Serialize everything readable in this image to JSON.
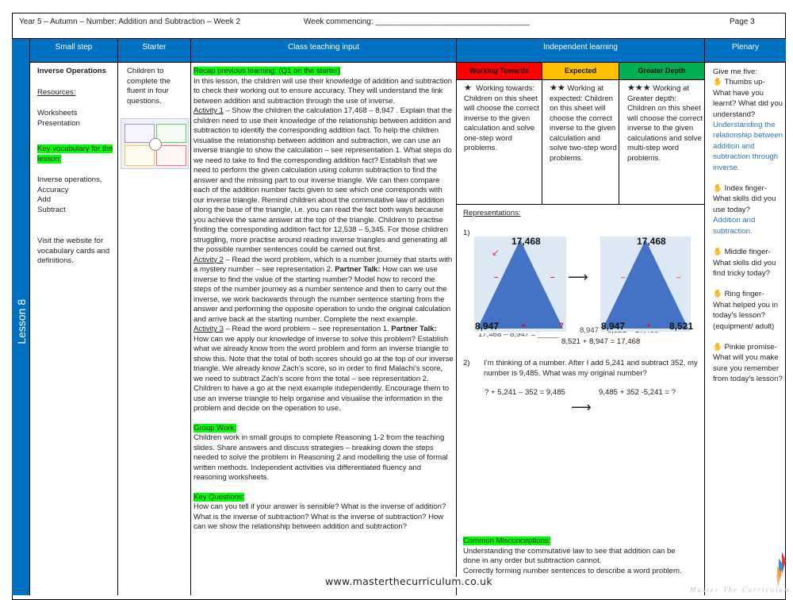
{
  "header": {
    "title": "Year 5 – Autumn – Number: Addition and Subtraction – Week 2",
    "week_commencing": "Week commencing: ___________________________________",
    "page": "Page 3"
  },
  "lesson_label": "Lesson 8",
  "columns": {
    "small_step": "Small step",
    "starter": "Starter",
    "class_teaching": "Class teaching input",
    "independent": "Independent learning",
    "plenary": "Plenary"
  },
  "small_step": {
    "title": "Inverse Operations",
    "resources_label": "Resources:",
    "resources": [
      "Worksheets",
      "Presentation"
    ],
    "vocab_label": "Key vocabulary for the lesson:",
    "vocab": [
      "Inverse operations,",
      "Accuracy",
      "Add",
      "Subtract"
    ],
    "website_note": "Visit the website for vocabulary cards and definitions."
  },
  "starter": {
    "text": "Children to complete the fluent in four questions."
  },
  "teaching": {
    "recap_label": "Recap previous learning: (Q1 on the starter)",
    "intro": "In this lesson, the children will use their knowledge of addition and subtraction to check their working out to ensure accuracy. They will understand the link between addition and subtraction through the use of inverse.",
    "a1_label": "Activity 1",
    "a1": " – Show the children the calculation 17,468 – 8,947 . Explain that the children need to use their knowledge of the relationship between addition and subtraction to identify the corresponding addition fact. To help the children visualise the relationship between addition and subtraction, we can use an inverse triangle to show the calculation – see representation 1. What steps do we need to take to find the corresponding addition fact? Establish that we need to perform the given calculation using column subtraction to find the answer and the missing part to our inverse triangle. We can then compare each of the addition number facts given to see which one corresponds with our inverse triangle. Remind children about the commutative law of addition along the base of the triangle, i.e. you can read the fact both ways because you achieve the same answer at the top of the triangle. Children to practise finding the corresponding addition fact for 12,538 – 5,345.  For those children struggling, more practise around reading inverse triangles and generating all the possible number sentences could be carried out first.",
    "a2_label": "Activity 2",
    "a2_pre": " – Read the word problem, which is a number journey that starts with a mystery number – see representation 2.  ",
    "partner_talk": "Partner Talk:",
    "a2_post": " How can we use inverse to find the value of the starting number? Model how to record the steps of the number journey as a number sentence and then to carry out the inverse, we work backwards through the number sentence starting from the answer and performing the opposite operation to undo the original calculation and arrive back at the starting number. Complete the next example.",
    "a3_label": "Activity 3",
    "a3_pre": " – Read the word problem – see representation 1. ",
    "a3_post": " How can we apply our knowledge of inverse to solve this problem? Establish what we already know from the word problem and form an inverse triangle to show this. Note that the total of both scores should go at the top of our inverse triangle. We already know Zach’s score, so in order to find Malachi’s score, we need to subtract Zach’s score from the total – see representation 2. Children to have a go at the next example independently. Encourage them to use an inverse triangle to help organise and visualise the information in the problem and decide on the operation to use.",
    "group_label": "Group Work:",
    "group": "Children work in small groups to complete Reasoning 1-2 from the teaching slides. Share answers and discuss strategies – breaking down the steps needed to solve the problem in Reasoning 2 and modelling the use of formal written methods. Independent activities via differentiated fluency and reasoning worksheets.",
    "kq_label": "Key Questions:",
    "kq": "How can you tell if your answer is sensible? What is the inverse of addition? What is the inverse of subtraction? What is the inverse of subtraction? How can we show the relationship between addition and subtraction?"
  },
  "independent": {
    "bands": [
      {
        "label": "Working Towards",
        "color": "#ff0000",
        "stars": 1,
        "text": "Working towards: Children on this sheet will choose the correct inverse to the given calculation and solve one-step word problems."
      },
      {
        "label": "Expected",
        "color": "#ffc000",
        "stars": 2,
        "text": "Working at expected: Children on this sheet will choose the correct inverse to the given calculation and solve two-step word problems."
      },
      {
        "label": "Greater Depth",
        "color": "#00b050",
        "stars": 3,
        "text": "Working at Greater depth: Children on this sheet will choose the correct inverse to the given calculations and solve multi-step word problems."
      }
    ],
    "representations_label": "Representations:",
    "rep1": {
      "num": "1)",
      "top": "17,468",
      "left": "8,947",
      "right_unknown": "?",
      "right": "8,521",
      "minus": "–",
      "plus": "+",
      "eq1": "17,468 – 8,947 = _____",
      "eq2": "8,947 + 8,521 = 17,468",
      "eq3": "8,521 + 8,947 = 17,468"
    },
    "rep2": {
      "num": "2)",
      "problem": "I’m thinking of a number. After I add 5,241 and subtract 352, my number is 9,485. What was my original number?",
      "eq1": "? + 5,241 – 352 = 9,485",
      "eq2": "9,485 + 352 -5,241 = ?"
    },
    "misconceptions_label": "Common Misconceptions:",
    "misconceptions": [
      "Understanding the commutative law to see that addition can be done in any order but subtraction cannot.",
      "Correctly forming number sentences to describe a word problem."
    ]
  },
  "plenary": {
    "intro": "Give me five:",
    "items": [
      {
        "label": "Thumbs up- What have you learnt? What did you understand?",
        "answer": "Understanding the relationship between addition and subtraction through inverse."
      },
      {
        "label": "Index finger- What skills did you use today?",
        "answer": "Addition and subtraction."
      },
      {
        "label": "Middle finger- What skills did you find tricky today?",
        "answer": ""
      },
      {
        "label": "Ring finger- What helped you in today’s lesson? (equipment/ adult)",
        "answer": ""
      },
      {
        "label": "Pinkie promise- What will you make sure you remember from today’s lesson?",
        "answer": ""
      }
    ]
  },
  "footer": {
    "website": "www.masterthecurriculum.co.uk",
    "logo_text": "Master The Curriculum"
  },
  "colors": {
    "header_blue": "#0070c0",
    "highlight": "#00ff00",
    "answer_blue": "#2e75b6",
    "triangle": "#4472c4"
  }
}
